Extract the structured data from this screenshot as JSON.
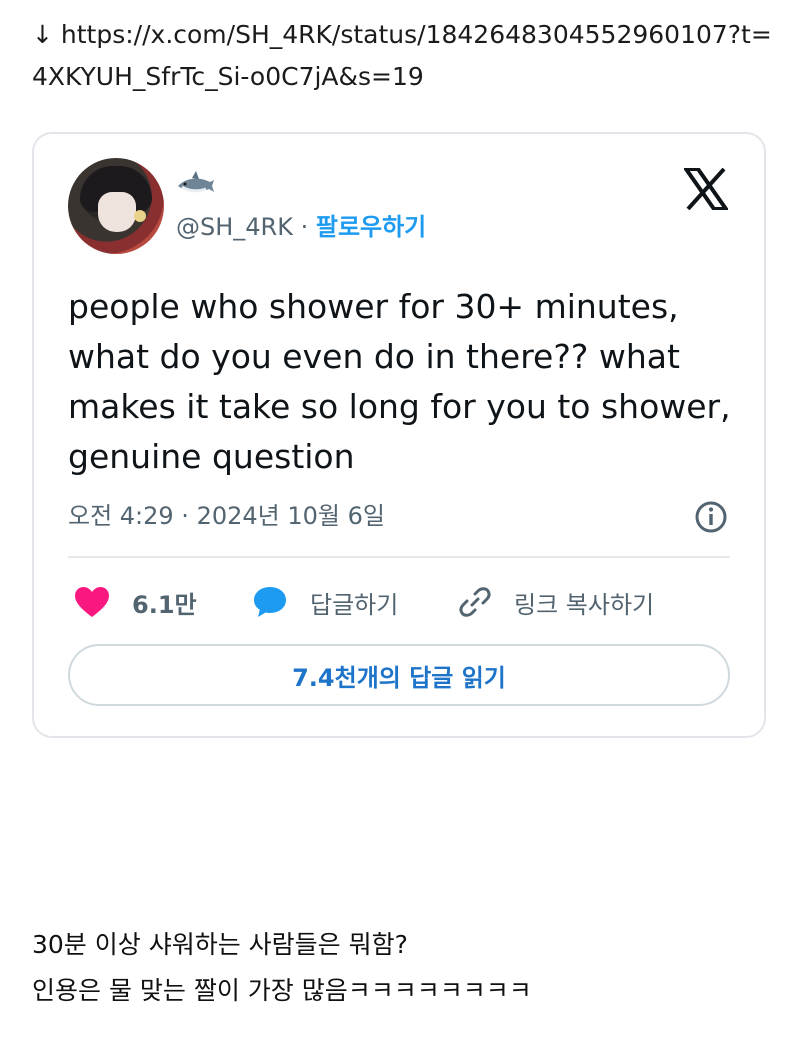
{
  "link": {
    "arrow": "↓",
    "url": "https://x.com/SH_4RK/status/1842648304552960107?t=4XKYUH_SfrTc_Si-o0C7jA&s=19"
  },
  "embed": {
    "emoji_icon": "shark-icon",
    "handle": "@SH_4RK",
    "separator": " · ",
    "follow_label": "팔로우하기",
    "text": "people who shower for 30+ minutes, what do you even do in there?? what makes it take so long for you to shower, genuine question",
    "timestamp": "오전 4:29 · 2024년 10월 6일",
    "likes": "6.1만",
    "reply_label": "답글하기",
    "copy_link_label": "링크 복사하기",
    "read_replies_label": "7.4천개의 답글 읽기",
    "colors": {
      "like": "#f91880",
      "reply": "#1d9bf0",
      "accent": "#1d74c9"
    }
  },
  "caption": {
    "line1": "30분 이상 샤워하는 사람들은 뭐함?",
    "line2": "인용은 물 맞는 짤이 가장 많음ㅋㅋㅋㅋㅋㅋㅋㅋ"
  }
}
